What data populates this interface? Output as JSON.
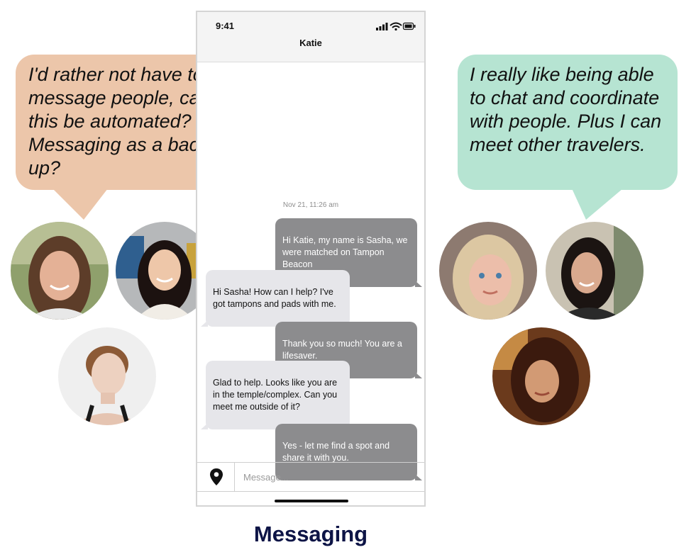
{
  "phone": {
    "status_time": "9:41",
    "contact_name": "Katie",
    "timestamp": "Nov 21, 11:26 am",
    "messages": [
      {
        "direction": "sent",
        "text": "Hi Katie, my name is Sasha, we were matched on Tampon Beacon"
      },
      {
        "direction": "received",
        "text": "Hi Sasha!  How can I help?  I've got tampons and pads with me."
      },
      {
        "direction": "sent",
        "text": "Thank you so much!  You are a lifesaver."
      },
      {
        "direction": "received",
        "text": "Glad to help.  Looks like you are in the temple/complex.  Can you meet me outside of it?"
      },
      {
        "direction": "sent",
        "text": "Yes - let me find a spot and share it with you."
      }
    ],
    "input": {
      "placeholder": "Message...",
      "value": ""
    },
    "location_icon": "map-pin-icon"
  },
  "callouts": {
    "left": "I'd rather not have to message people, can this be automated? Messaging as a back-up?",
    "right": "I really like being able to chat and coordinate with people.  Plus I can meet other travelers."
  },
  "caption": "Messaging",
  "colors": {
    "left_callout": "#ecc6aa",
    "right_callout": "#b6e4d2",
    "sent_bubble": "#8c8c8e",
    "received_bubble": "#e6e6ea",
    "caption": "#0d1446"
  }
}
